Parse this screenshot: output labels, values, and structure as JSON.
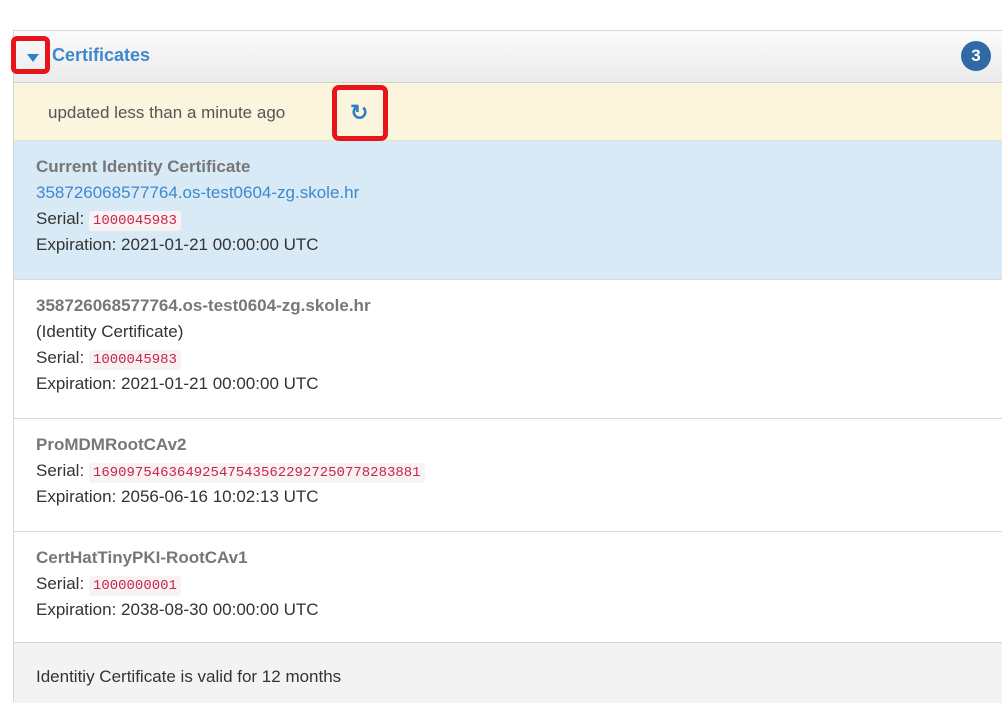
{
  "panel": {
    "title": "Certificates",
    "count": "3",
    "status_text": "updated less than a minute ago",
    "icons": {
      "toggle": "caret-down-icon",
      "refresh": "refresh-icon"
    }
  },
  "certificates": [
    {
      "name": "Current Identity Certificate",
      "link": "358726068577764.os-test0604-zg.skole.hr",
      "serial_label": "Serial:",
      "serial": "1000045983",
      "expiration": "Expiration: 2021-01-21 00:00:00 UTC"
    },
    {
      "name": "358726068577764.os-test0604-zg.skole.hr",
      "subtitle": "(Identity Certificate)",
      "serial_label": "Serial:",
      "serial": "1000045983",
      "expiration": "Expiration: 2021-01-21 00:00:00 UTC"
    },
    {
      "name": "ProMDMRootCAv2",
      "serial_label": "Serial:",
      "serial": "169097546364925475435622927250778283881",
      "expiration": "Expiration: 2056-06-16 10:02:13 UTC"
    },
    {
      "name": "CertHatTinyPKI-RootCAv1",
      "serial_label": "Serial:",
      "serial": "1000000001",
      "expiration": "Expiration: 2038-08-30 00:00:00 UTC"
    }
  ],
  "footer": {
    "text": "Identitiy Certificate is valid for 12 months"
  },
  "colors": {
    "accent": "#3f87cf",
    "highlight": "#e8141b",
    "status_bg": "#fcf5de",
    "active_bg": "#d8eaf5"
  }
}
